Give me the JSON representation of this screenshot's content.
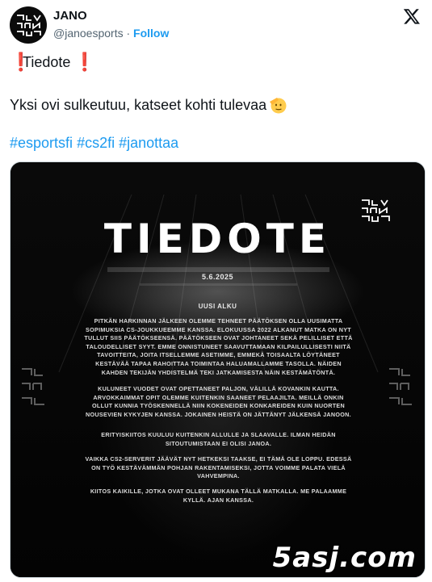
{
  "author": {
    "name": "JANO",
    "handle": "@janoesports",
    "separator": "·",
    "follow_label": "Follow",
    "avatar_text": "JANO"
  },
  "platform_icon": "x-logo-icon",
  "tweet": {
    "line1": "Tiedote",
    "line2": "Yksi ovi sulkeutuu, katseet kohti tulevaa",
    "hashtags": [
      "#esportsfi",
      "#cs2fi",
      "#janottaa"
    ],
    "emoji": "saluting-face-icon",
    "bang": "❗"
  },
  "poster": {
    "title": "TIEDOTE",
    "date": "5.6.2025",
    "subtitle": "UUSI ALKU",
    "paragraphs": [
      "Pitkän harkinnan jälkeen olemme tehneet päätöksen olla uusimatta sopimuksia CS-joukkueemme kanssa. Elokuussa 2022 alkanut matka on nyt tullut siis päätökseensä. Päätökseen ovat johtaneet sekä pelilliset että taloudelliset syyt. Emme onnistuneet saavuttamaan kilpailullisesti niitä tavoitteita, joita itsellemme asetimme, emmekä toisaalta löytäneet kestävää tapaa rahoittaa toimintaa haluamallamme tasolla. Näiden kahden tekijän yhdistelmä teki jatkamisesta näin kestämätöntä.",
      "Kuluneet vuodet ovat opettaneet paljon, välillä kovankin kautta. Arvokkaimmat opit olemme kuitenkin saaneet pelaajilta. Meillä onkin ollut kunnia työskennellä niin kokeneiden konkareiden kuin nuorten nousevien kykyjen kanssa. Jokainen heistä on jättänyt jälkensä Janoon.",
      "Erityiskiitos kuuluu kuitenkin allulle ja slaavalle. Ilman heidän sitoutumistaan ei olisi Janoa.",
      "Vaikka CS2-serverit jäävät nyt hetkeksi taakse, ei tämä ole loppu. Edessä on työ kestävämmän pohjan rakentamiseksi, jotta voimme palata vielä vahvempina.",
      "Kiitos kaikille, jotka ovat olleet mukana tällä matkalla. Me palaamme kyllä. Ajan kanssa."
    ],
    "watermark": "5asj.com",
    "colors": {
      "background": "#050505",
      "text": "#dcdcdc"
    }
  },
  "colors": {
    "link": "#1d9bf0",
    "text": "#0f1419",
    "muted": "#536471",
    "bang": "#e0241c"
  }
}
